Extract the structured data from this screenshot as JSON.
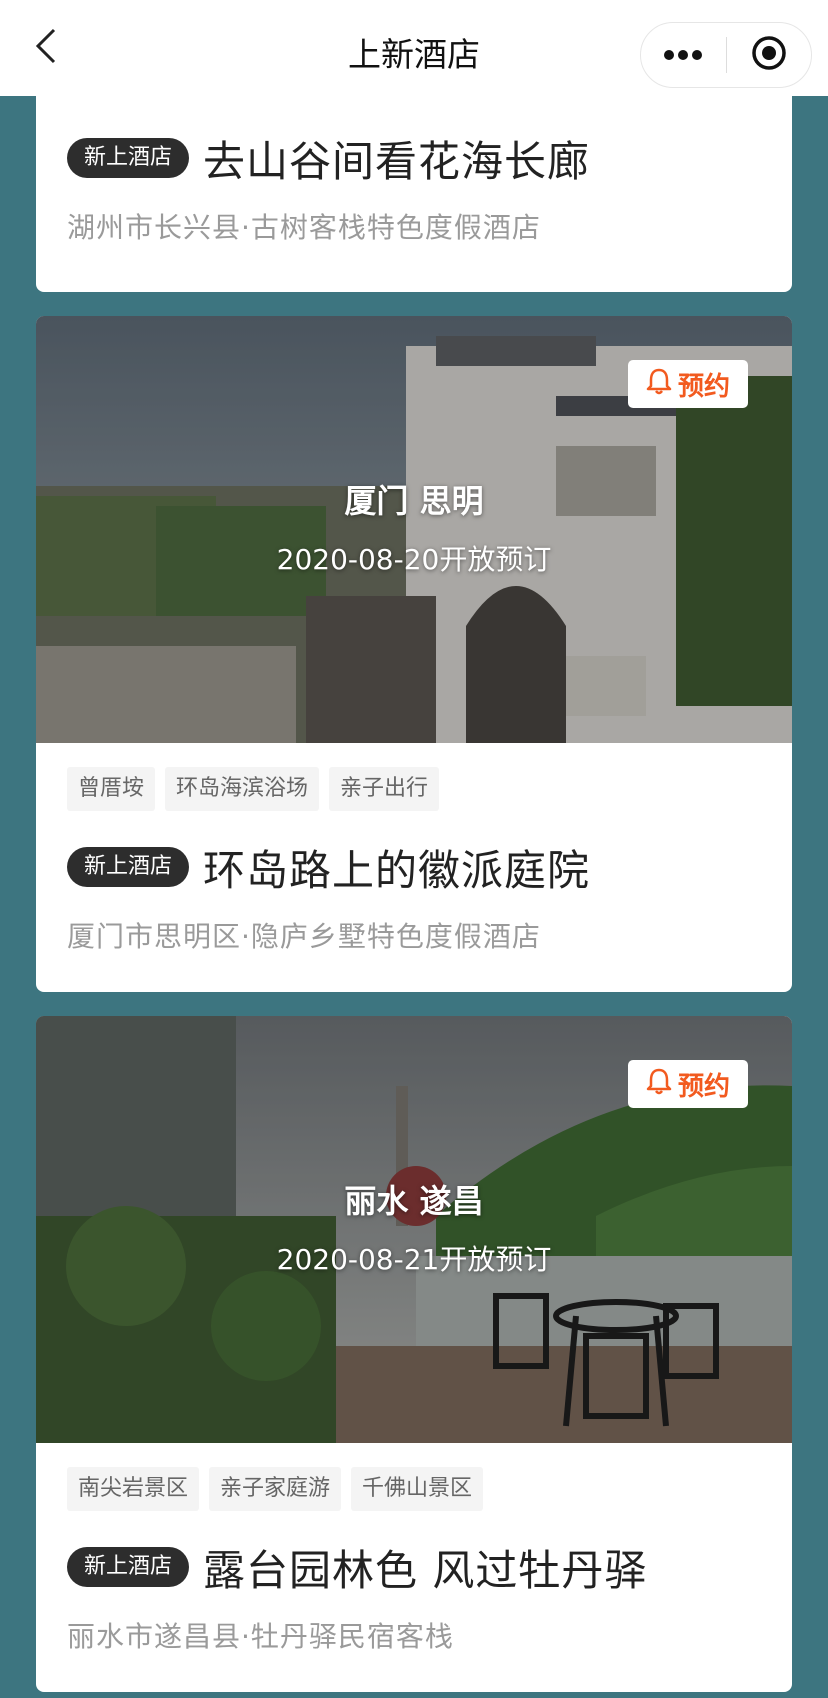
{
  "header": {
    "title": "上新酒店",
    "back_icon": "chevron-left-icon",
    "more_icon": "more-dots-icon",
    "close_icon": "target-circle-icon"
  },
  "accent_color": "#f25a1f",
  "cards": [
    {
      "badge": "新上酒店",
      "title": "去山谷间看花海长廊",
      "location": "湖州市长兴县·古树客栈特色度假酒店"
    },
    {
      "city": "厦门 思明",
      "open_date": "2020-08-20开放预订",
      "reserve_label": "预约",
      "tags": [
        "曾厝垵",
        "环岛海滨浴场",
        "亲子出行"
      ],
      "badge": "新上酒店",
      "title": "环岛路上的徽派庭院",
      "location": "厦门市思明区·隐庐乡墅特色度假酒店"
    },
    {
      "city": "丽水 遂昌",
      "open_date": "2020-08-21开放预订",
      "reserve_label": "预约",
      "tags": [
        "南尖岩景区",
        "亲子家庭游",
        "千佛山景区"
      ],
      "badge": "新上酒店",
      "title": "露台园林色 风过牡丹驿",
      "location": "丽水市遂昌县·牡丹驿民宿客栈"
    }
  ]
}
